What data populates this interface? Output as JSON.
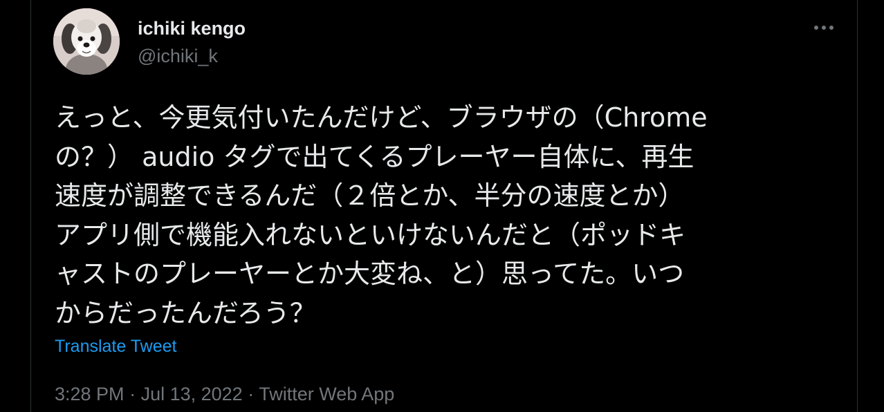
{
  "author": {
    "name": "ichiki kengo",
    "handle": "@ichiki_k"
  },
  "tweet": {
    "text": "えっと、今更気付いたんだけど、ブラウザの（Chrome\nの？） audio タグで出てくるプレーヤー自体に、再生\n速度が調整できるんだ（２倍とか、半分の速度とか）\nアプリ側で機能入れないといけないんだと（ポッドキ\nャストのプレーヤーとか大変ね、と）思ってた。いつ\nからだったんだろう？",
    "translate_label": "Translate Tweet"
  },
  "meta": {
    "time": "3:28 PM",
    "separator": " · ",
    "date": "Jul 13, 2022",
    "source": "Twitter Web App"
  },
  "icons": {
    "more": "more-horizontal-icon",
    "avatar": "dog-avatar-image"
  },
  "colors": {
    "background": "#000000",
    "text_primary": "#e7e9ea",
    "text_secondary": "#71767b",
    "link": "#1d9bf0",
    "border": "#2f3336"
  }
}
